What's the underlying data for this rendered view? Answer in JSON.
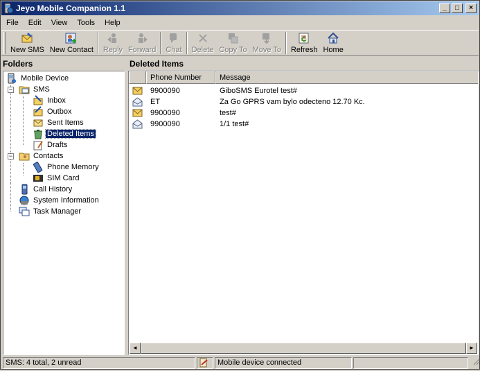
{
  "window": {
    "title": "Jeyo Mobile Companion 1.1",
    "min": "_",
    "max": "□",
    "close": "×"
  },
  "menu": [
    "File",
    "Edit",
    "View",
    "Tools",
    "Help"
  ],
  "toolbar": {
    "new_sms": "New SMS",
    "new_contact": "New Contact",
    "reply": "Reply",
    "forward": "Forward",
    "chat": "Chat",
    "delete": "Delete",
    "copy_to": "Copy To",
    "move_to": "Move To",
    "refresh": "Refresh",
    "home": "Home"
  },
  "folders_header": "Folders",
  "tree": {
    "mobile_device": "Mobile Device",
    "sms": "SMS",
    "inbox": "Inbox",
    "outbox": "Outbox",
    "sent_items": "Sent Items",
    "deleted_items": "Deleted Items",
    "drafts": "Drafts",
    "contacts": "Contacts",
    "phone_memory": "Phone Memory",
    "sim_card": "SIM Card",
    "call_history": "Call History",
    "system_information": "System Information",
    "task_manager": "Task Manager",
    "expand_minus": "−"
  },
  "list": {
    "header": "Deleted Items",
    "columns": {
      "phone": "Phone Number",
      "message": "Message"
    },
    "rows": [
      {
        "phone": "9900090",
        "message": "GiboSMS Eurotel test#",
        "state": "unread"
      },
      {
        "phone": "ET",
        "message": "Za Go GPRS vam bylo odecteno 12.70 Kc.",
        "state": "read"
      },
      {
        "phone": "9900090",
        "message": "test#",
        "state": "unread"
      },
      {
        "phone": "9900090",
        "message": "1/1 test#",
        "state": "read"
      }
    ]
  },
  "status": {
    "sms": "SMS: 4 total, 2 unread",
    "connection": "Mobile device connected"
  },
  "scroll": {
    "left": "◄",
    "right": "►"
  }
}
